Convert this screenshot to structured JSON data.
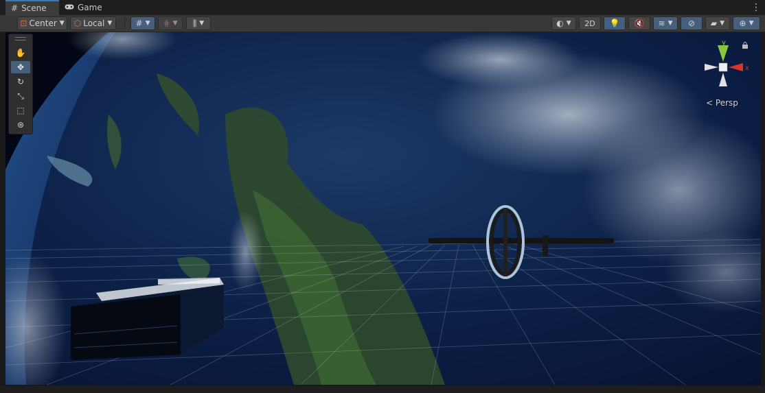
{
  "tabs": [
    {
      "label": "Scene",
      "icon": "hash-icon",
      "active": true
    },
    {
      "label": "Game",
      "icon": "gamepad-icon",
      "active": false
    }
  ],
  "toolbar": {
    "pivot_mode": "Center",
    "pivot_space": "Local",
    "mode_2d": "2D"
  },
  "scene_view": {
    "projection_label": "Persp",
    "gizmo_axes": {
      "y": "y",
      "x": "x"
    }
  },
  "tools": [
    {
      "name": "hand-tool",
      "active": false
    },
    {
      "name": "move-tool",
      "active": true
    },
    {
      "name": "rotate-tool",
      "active": false
    },
    {
      "name": "scale-tool",
      "active": false
    },
    {
      "name": "rect-tool",
      "active": false
    },
    {
      "name": "transform-tool",
      "active": false
    }
  ],
  "colors": {
    "accent": "#46607c",
    "tab_highlight": "#3a79bb",
    "gizmo_x": "#d9352f",
    "gizmo_y": "#8cc63f"
  }
}
